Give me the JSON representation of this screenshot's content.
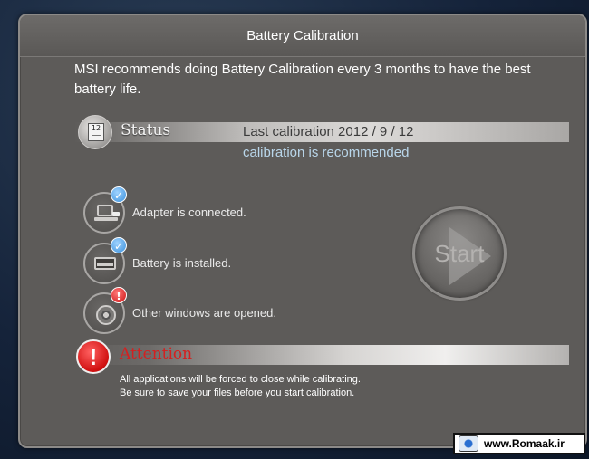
{
  "window": {
    "title": "Battery Calibration"
  },
  "intro": "MSI recommends doing Battery Calibration every 3 months to have the best battery life.",
  "status": {
    "heading": "Status",
    "calendar_icon_text": "12",
    "last_calibration": "Last calibration 2012 / 9 / 12",
    "recommendation": "calibration is recommended"
  },
  "checks": [
    {
      "label": "Adapter is connected.",
      "icon": "adapter-icon",
      "state": "ok"
    },
    {
      "label": "Battery is installed.",
      "icon": "battery-icon",
      "state": "ok"
    },
    {
      "label": "Other windows are opened.",
      "icon": "disc-icon",
      "state": "warning"
    }
  ],
  "badges": {
    "ok": "✓",
    "warning": "!"
  },
  "start_button": {
    "label": "Start"
  },
  "attention": {
    "icon_text": "!",
    "heading": "Attention",
    "line1": "All applications will be forced to close while calibrating.",
    "line2": "Be sure to save your files before you start calibration."
  },
  "watermark": {
    "text": "www.Romaak.ir"
  },
  "colors": {
    "dialog_bg": "#5d5b59",
    "recommend_text": "#b9d6ea",
    "attention_red": "#d42020",
    "ok_badge": "#3a8fdb",
    "warn_badge": "#cc1010"
  }
}
